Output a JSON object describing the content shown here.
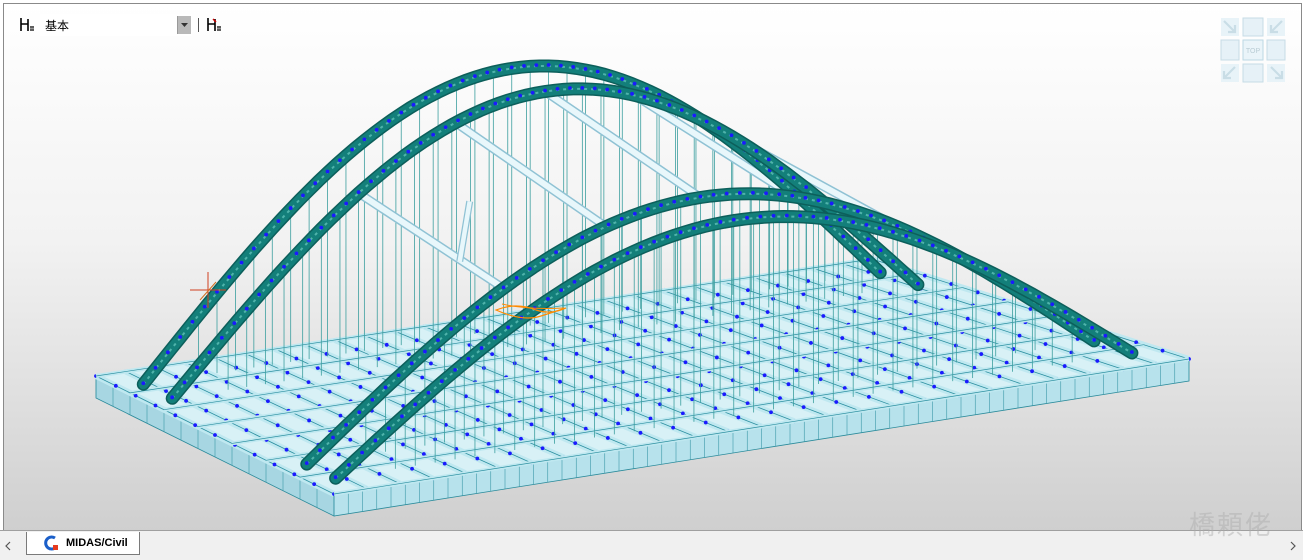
{
  "toolbar": {
    "view_set_selected": "基本",
    "left_icon": "ruler-axis-icon",
    "right_icon": "ruler-axis-red-icon",
    "dropdown_icon": "chevron-down-icon"
  },
  "view_cube": {
    "face_label": "TOP",
    "icons": [
      "arrow-se-icon",
      "arrow-sw-icon",
      "arrow-ne-icon",
      "arrow-nw-icon"
    ]
  },
  "tabs": [
    {
      "label": "MIDAS/Civil",
      "icon": "midas-civil-app-icon",
      "active": true
    }
  ],
  "watermark": "橋頼佬",
  "colors": {
    "arch_teal": "#137f7a",
    "beam_light_blue": "#bfe8f0",
    "node_blue": "#1a1aff",
    "hanger": "#3c9f9f",
    "highlight_orange": "#ff8a00"
  }
}
